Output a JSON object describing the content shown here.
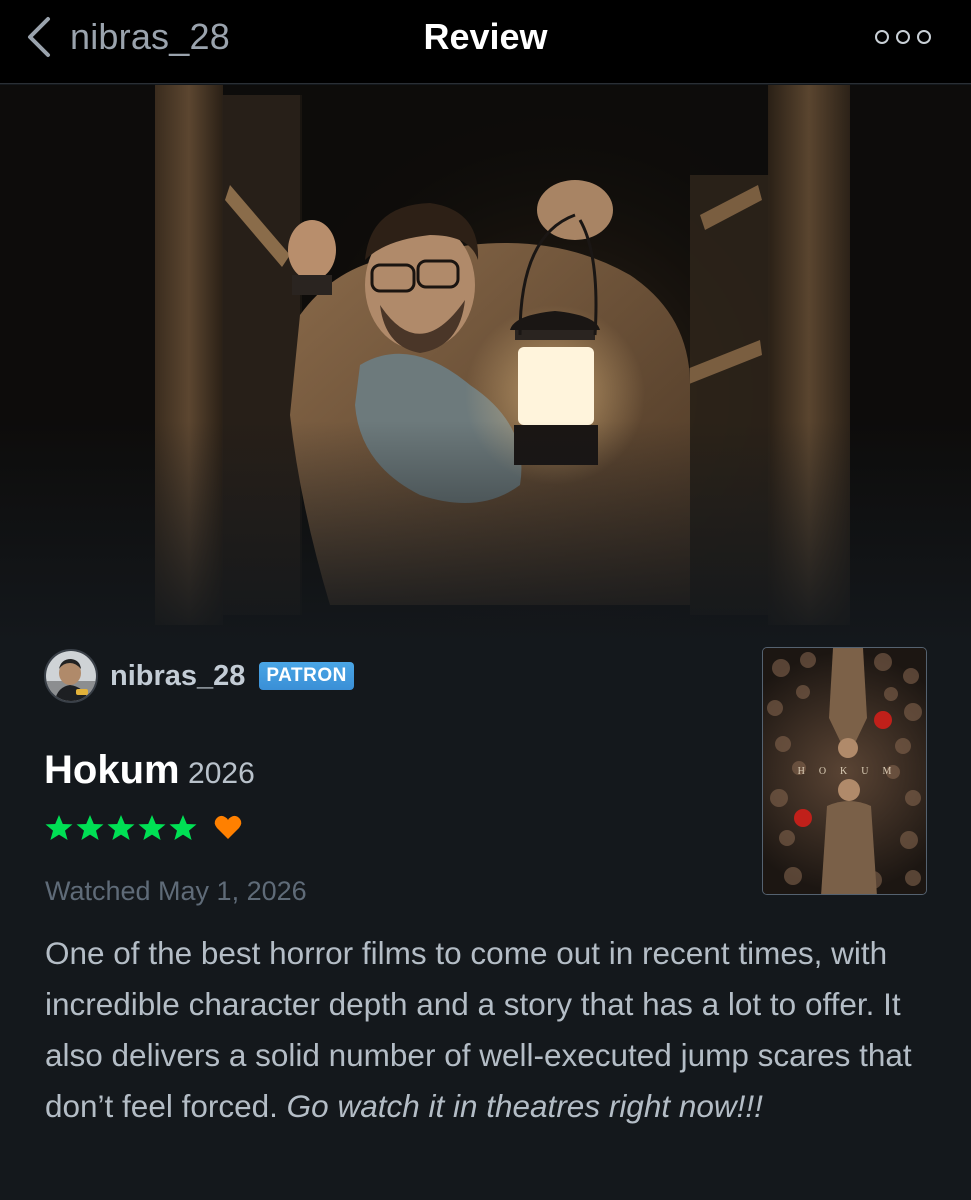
{
  "nav": {
    "back_label": "nibras_28",
    "title": "Review",
    "more_icon": "more-dots-icon"
  },
  "reviewer": {
    "username": "nibras_28",
    "badge": "PATRON"
  },
  "film": {
    "title": "Hokum",
    "year": "2026",
    "poster_title": "HOKUM"
  },
  "rating": {
    "stars": 5,
    "max_stars": 5,
    "liked": true,
    "star_color": "#00e054",
    "heart_color": "#ff8000"
  },
  "watched_text": "Watched May 1, 2026",
  "review": {
    "body": "One of the best horror films to come out in recent times, with incredible character depth and a story that has a lot to offer. It also delivers a solid number of well-executed jump scares that don’t feel forced.",
    "emphasis": "Go watch it in theatres right now!!!"
  },
  "colors": {
    "background": "#14181c",
    "navbar": "#000000",
    "patron_badge": "#3a8fd6"
  }
}
